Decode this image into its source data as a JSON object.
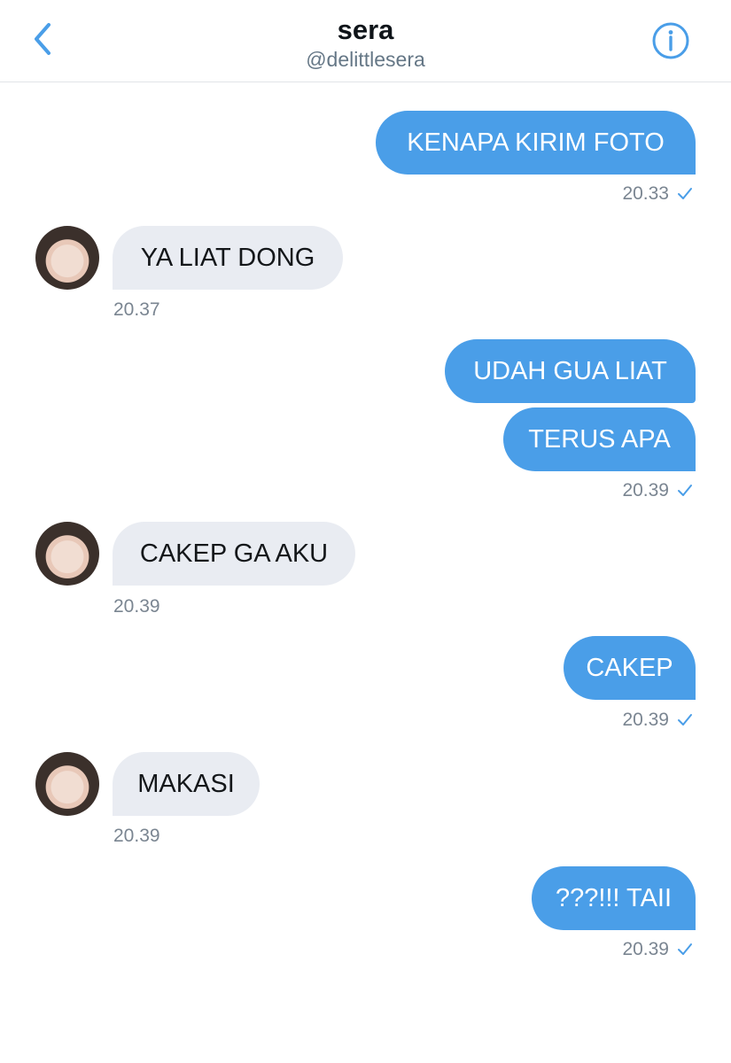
{
  "header": {
    "title": "sera",
    "handle": "@delittlesera",
    "back_icon": "chevron-left-icon",
    "info_icon": "info-icon"
  },
  "colors": {
    "accent": "#4a9ee8",
    "incoming_bubble": "#e9ecf2",
    "meta_text": "#7a8591"
  },
  "messages": [
    {
      "direction": "out",
      "text": "KENAPA KIRIM FOTO"
    },
    {
      "direction": "out",
      "time": "20.33",
      "seen": true
    },
    {
      "direction": "in",
      "text": "YA LIAT DONG"
    },
    {
      "direction": "in",
      "time": "20.37"
    },
    {
      "direction": "out",
      "text": "UDAH GUA LIAT"
    },
    {
      "direction": "out",
      "text": "TERUS APA"
    },
    {
      "direction": "out",
      "time": "20.39",
      "seen": true
    },
    {
      "direction": "in",
      "text": "CAKEP GA AKU"
    },
    {
      "direction": "in",
      "time": "20.39"
    },
    {
      "direction": "out",
      "text": "CAKEP"
    },
    {
      "direction": "out",
      "time": "20.39",
      "seen": true
    },
    {
      "direction": "in",
      "text": "MAKASI"
    },
    {
      "direction": "in",
      "time": "20.39"
    },
    {
      "direction": "out",
      "text": "???!!! TAII"
    },
    {
      "direction": "out",
      "time": "20.39",
      "seen": true
    }
  ]
}
